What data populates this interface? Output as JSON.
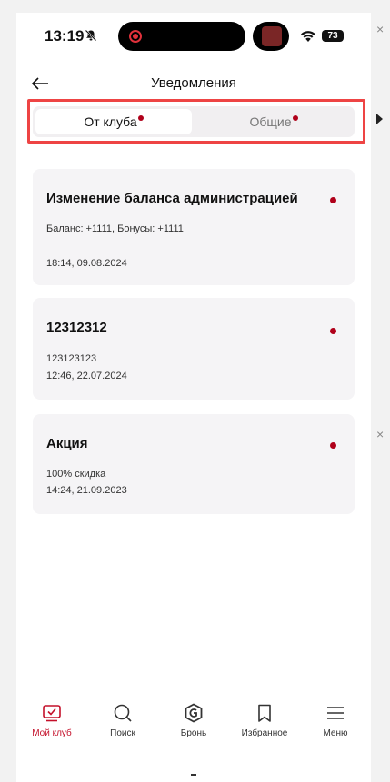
{
  "status_bar": {
    "time": "13:19",
    "battery": "73"
  },
  "header": {
    "title": "Уведомления"
  },
  "tabs": [
    {
      "label": "От клуба",
      "active": true,
      "has_dot": true
    },
    {
      "label": "Общие",
      "active": false,
      "has_dot": true
    }
  ],
  "notifications": [
    {
      "title": "Изменение баланса администрацией",
      "line1": "Баланс: +1111, Бонусы: +1111",
      "line2": "18:14, 09.08.2024",
      "unread": true
    },
    {
      "title": "12312312",
      "line1": "123123123",
      "line2": "12:46, 22.07.2024",
      "unread": true
    },
    {
      "title": "Акция",
      "line1": "100% скидка",
      "line2": "14:24, 21.09.2023",
      "unread": true
    }
  ],
  "bottom_nav": [
    {
      "label": "Мой клуб",
      "icon": "club-icon",
      "active": true
    },
    {
      "label": "Поиск",
      "icon": "search-icon",
      "active": false
    },
    {
      "label": "Бронь",
      "icon": "booking-icon",
      "active": false
    },
    {
      "label": "Избранное",
      "icon": "bookmark-icon",
      "active": false
    },
    {
      "label": "Меню",
      "icon": "menu-icon",
      "active": false
    }
  ],
  "colors": {
    "accent": "#c4102a",
    "unread_dot": "#b0001a",
    "highlight_border": "#ee4444",
    "card_bg": "#f5f4f6"
  }
}
